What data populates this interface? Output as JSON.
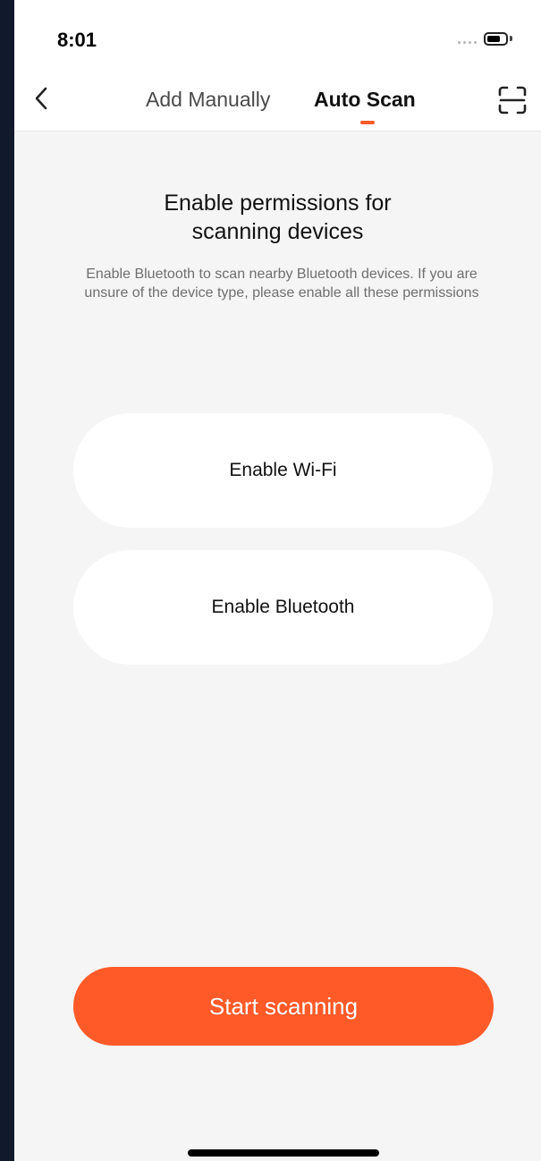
{
  "status_bar": {
    "time": "8:01",
    "battery_level": 0.75
  },
  "header": {
    "back_icon": "chevron-left-icon",
    "tabs": [
      {
        "label": "Add Manually",
        "active": false
      },
      {
        "label": "Auto Scan",
        "active": true
      }
    ],
    "scan_icon": "qr-scan-icon",
    "accent_color": "#ff5a28"
  },
  "main": {
    "title_line1": "Enable permissions for",
    "title_line2": "scanning devices",
    "description": "Enable Bluetooth to scan nearby Bluetooth devices. If you are unsure of the device type, please enable all these permissions",
    "permissions": [
      {
        "label": "Enable Wi-Fi"
      },
      {
        "label": "Enable Bluetooth"
      }
    ],
    "start_button": {
      "label": "Start scanning",
      "color": "#ff5a28"
    }
  }
}
